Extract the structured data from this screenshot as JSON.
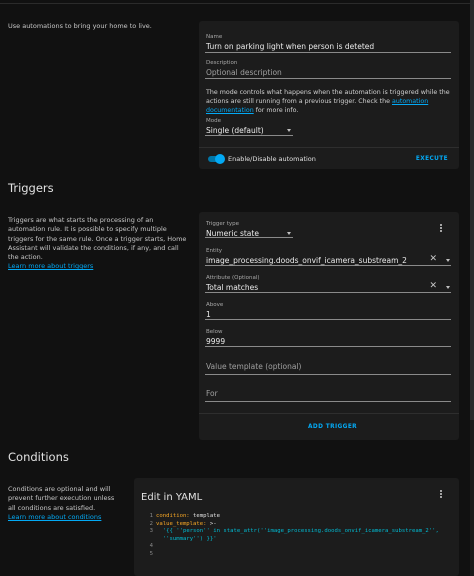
{
  "intro": {
    "text": "Use automations to bring your home to live."
  },
  "automation": {
    "name_label": "Name",
    "name_value": "Turn on parking light when person is deteted",
    "description_label": "Description",
    "description_placeholder": "Optional description",
    "mode_info_prefix": "The mode controls what happens when the automation is triggered while the actions are still running from a previous trigger. Check the",
    "mode_info_link": "automation documentation",
    "mode_info_suffix": "for more info.",
    "mode_label": "Mode",
    "mode_value": "Single (default)",
    "toggle_label": "Enable/Disable automation",
    "toggle_on": true,
    "execute_label": "EXECUTE"
  },
  "triggers": {
    "title": "Triggers",
    "description": "Triggers are what starts the processing of an automation rule. It is possible to specify multiple triggers for the same rule. Once a trigger starts, Home Assistant will validate the conditions, if any, and call the action.",
    "learn_more": "Learn more about triggers",
    "trigger_type_label": "Trigger type",
    "trigger_type_value": "Numeric state",
    "entity_label": "Entity",
    "entity_value": "image_processing.doods_onvif_icamera_substream_2",
    "attribute_label": "Attribute (Optional)",
    "attribute_value": "Total matches",
    "above_label": "Above",
    "above_value": "1",
    "below_label": "Below",
    "below_value": "9999",
    "value_template_placeholder": "Value template (optional)",
    "for_placeholder": "For",
    "add_trigger_label": "ADD TRIGGER"
  },
  "conditions": {
    "title": "Conditions",
    "description": "Conditions are optional and will prevent further execution unless all conditions are satisfied.",
    "learn_more": "Learn more about conditions",
    "yaml_title": "Edit in YAML",
    "code": {
      "l1_key": "condition:",
      "l1_val": " template",
      "l2_key": "value_template:",
      "l2_val": " >-",
      "l3": "'{{ ''person'' in state_attr(''image_processing.doods_onvif_icamera_substream_2'',",
      "l4": "''summary'') }}'",
      "n1": "1",
      "n2": "2",
      "n3": "3",
      "n4": "4",
      "n5": "5"
    }
  },
  "colors": {
    "accent": "#03a9f4",
    "card": "#1c1c1c",
    "background": "#111111",
    "yaml_key": "#f9a825"
  },
  "icons": [
    "kebab-menu-icon",
    "close-icon",
    "chevron-down-icon"
  ]
}
